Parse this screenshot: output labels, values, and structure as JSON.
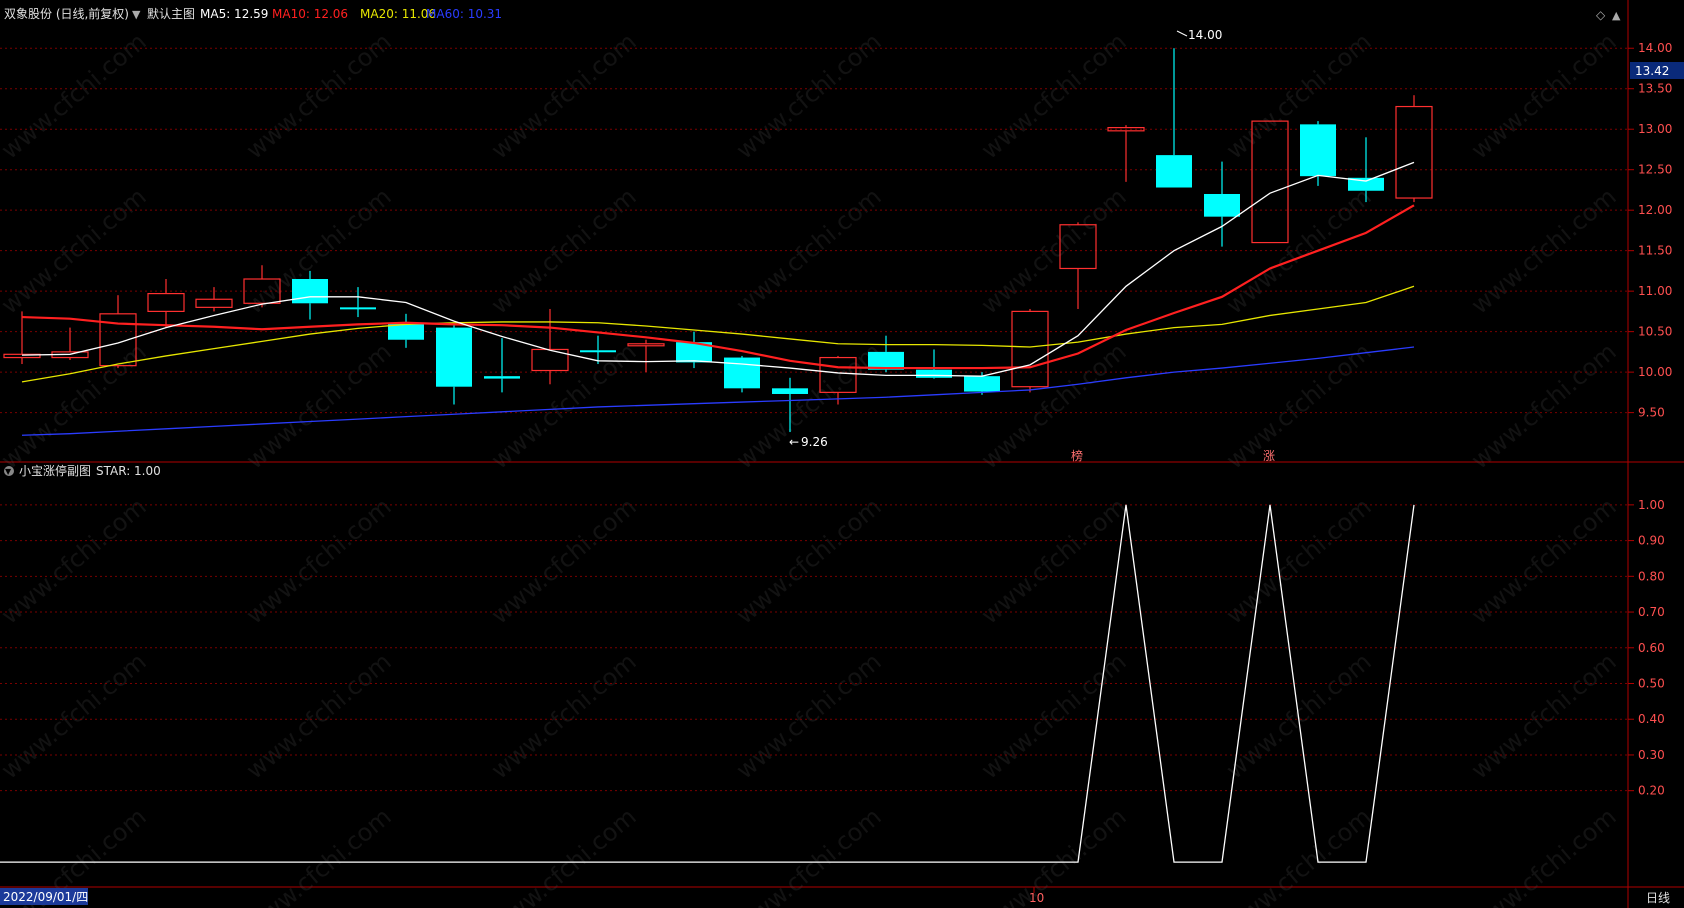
{
  "header": {
    "stock": "双象股份 (日线,前复权)",
    "chart_name": "默认主图",
    "indicators": [
      {
        "label": "MA5: 12.59",
        "color": "#ffffff"
      },
      {
        "label": "MA10: 12.06",
        "color": "#ff2020"
      },
      {
        "label": "MA20: 11.06",
        "color": "#e6e600"
      },
      {
        "label": "MA60: 10.31",
        "color": "#2a3cff"
      }
    ]
  },
  "sub_header": {
    "title": "小宝涨停副图",
    "value": "STAR: 1.00"
  },
  "markers": {
    "high_label": "14.00",
    "low_label": "9.26",
    "current_price": "13.42",
    "tag1": "榜",
    "tag2": "涨"
  },
  "footer": {
    "date": "2022/09/01/四",
    "month": "10",
    "period": "日线"
  },
  "watermark": "www.cfchi.com",
  "colors": {
    "up": "#ff3030",
    "down": "#00ffff",
    "ma5": "#ffffff",
    "ma10": "#ff2020",
    "ma20": "#e6e600",
    "ma60": "#2a3cff",
    "grid": "#7a0000",
    "axis": "#b00000"
  },
  "chart_data": [
    {
      "type": "candlestick",
      "y_ticks": [
        "9.50",
        "10.00",
        "10.50",
        "11.00",
        "11.50",
        "12.00",
        "12.50",
        "13.00",
        "13.50",
        "14.00"
      ],
      "ylim": [
        9.1,
        14.25
      ],
      "candles": [
        {
          "o": 10.18,
          "h": 10.75,
          "l": 10.1,
          "c": 10.22
        },
        {
          "o": 10.18,
          "h": 10.55,
          "l": 10.15,
          "c": 10.25
        },
        {
          "o": 10.08,
          "h": 10.95,
          "l": 10.05,
          "c": 10.72
        },
        {
          "o": 10.75,
          "h": 11.15,
          "l": 10.55,
          "c": 10.97
        },
        {
          "o": 10.8,
          "h": 11.05,
          "l": 10.75,
          "c": 10.9
        },
        {
          "o": 10.85,
          "h": 11.32,
          "l": 10.8,
          "c": 11.15
        },
        {
          "o": 11.15,
          "h": 11.25,
          "l": 10.65,
          "c": 10.85
        },
        {
          "o": 10.8,
          "h": 11.05,
          "l": 10.68,
          "c": 10.78
        },
        {
          "o": 10.6,
          "h": 10.72,
          "l": 10.3,
          "c": 10.4
        },
        {
          "o": 10.55,
          "h": 10.58,
          "l": 9.6,
          "c": 9.82
        },
        {
          "o": 9.95,
          "h": 10.42,
          "l": 9.75,
          "c": 9.92
        },
        {
          "o": 10.02,
          "h": 10.78,
          "l": 9.85,
          "c": 10.28
        },
        {
          "o": 10.27,
          "h": 10.45,
          "l": 10.1,
          "c": 10.25
        },
        {
          "o": 10.33,
          "h": 10.4,
          "l": 10.0,
          "c": 10.35
        },
        {
          "o": 10.37,
          "h": 10.5,
          "l": 10.05,
          "c": 10.12
        },
        {
          "o": 10.18,
          "h": 10.2,
          "l": 9.75,
          "c": 9.8
        },
        {
          "o": 9.8,
          "h": 9.93,
          "l": 9.26,
          "c": 9.73
        },
        {
          "o": 9.75,
          "h": 10.2,
          "l": 9.6,
          "c": 10.18
        },
        {
          "o": 10.25,
          "h": 10.45,
          "l": 10.0,
          "c": 10.03
        },
        {
          "o": 10.03,
          "h": 10.28,
          "l": 9.92,
          "c": 9.93
        },
        {
          "o": 9.95,
          "h": 10.0,
          "l": 9.72,
          "c": 9.76
        },
        {
          "o": 9.82,
          "h": 10.78,
          "l": 9.75,
          "c": 10.75
        },
        {
          "o": 11.28,
          "h": 11.85,
          "l": 10.78,
          "c": 11.82
        },
        {
          "o": 12.98,
          "h": 13.05,
          "l": 12.35,
          "c": 13.02
        },
        {
          "o": 12.68,
          "h": 14.0,
          "l": 12.3,
          "c": 12.28
        },
        {
          "o": 12.2,
          "h": 12.6,
          "l": 11.55,
          "c": 11.92
        },
        {
          "o": 11.6,
          "h": 13.1,
          "l": 11.6,
          "c": 13.1
        },
        {
          "o": 13.06,
          "h": 13.1,
          "l": 12.3,
          "c": 12.42
        },
        {
          "o": 12.4,
          "h": 12.9,
          "l": 12.1,
          "c": 12.24
        },
        {
          "o": 12.15,
          "h": 13.42,
          "l": 12.1,
          "c": 13.28
        }
      ],
      "ma5": [
        10.21,
        10.22,
        10.36,
        10.55,
        10.7,
        10.84,
        10.93,
        10.93,
        10.86,
        10.63,
        10.44,
        10.27,
        10.14,
        10.13,
        10.14,
        10.1,
        10.05,
        9.99,
        9.96,
        9.96,
        9.95,
        10.09,
        10.45,
        11.06,
        11.5,
        11.8,
        12.21,
        12.43,
        12.36,
        12.59
      ],
      "ma10": [
        10.68,
        10.66,
        10.6,
        10.58,
        10.56,
        10.53,
        10.56,
        10.59,
        10.61,
        10.59,
        10.58,
        10.55,
        10.49,
        10.43,
        10.36,
        10.26,
        10.14,
        10.06,
        10.05,
        10.05,
        10.05,
        10.06,
        10.23,
        10.52,
        10.73,
        10.93,
        11.28,
        11.5,
        11.72,
        12.06
      ],
      "ma20": [
        9.88,
        9.98,
        10.1,
        10.2,
        10.29,
        10.38,
        10.47,
        10.54,
        10.59,
        10.61,
        10.62,
        10.62,
        10.61,
        10.57,
        10.52,
        10.47,
        10.41,
        10.35,
        10.34,
        10.34,
        10.33,
        10.31,
        10.37,
        10.47,
        10.55,
        10.59,
        10.7,
        10.78,
        10.86,
        11.06
      ],
      "ma60": [
        9.22,
        9.24,
        9.27,
        9.3,
        9.33,
        9.36,
        9.39,
        9.42,
        9.45,
        9.48,
        9.51,
        9.54,
        9.57,
        9.59,
        9.61,
        9.63,
        9.65,
        9.67,
        9.69,
        9.72,
        9.75,
        9.78,
        9.85,
        9.93,
        10.0,
        10.05,
        10.11,
        10.17,
        10.24,
        10.31
      ]
    },
    {
      "type": "line",
      "name": "STAR",
      "y_ticks": [
        "0.20",
        "0.30",
        "0.40",
        "0.50",
        "0.60",
        "0.70",
        "0.80",
        "0.90",
        "1.00"
      ],
      "ylim": [
        -0.05,
        1.05
      ],
      "values": [
        0,
        0,
        0,
        0,
        0,
        0,
        0,
        0,
        0,
        0,
        0,
        0,
        0,
        0,
        0,
        0,
        0,
        0,
        0,
        0,
        0,
        0,
        0,
        1,
        0,
        0,
        1,
        0,
        0,
        1
      ]
    }
  ]
}
